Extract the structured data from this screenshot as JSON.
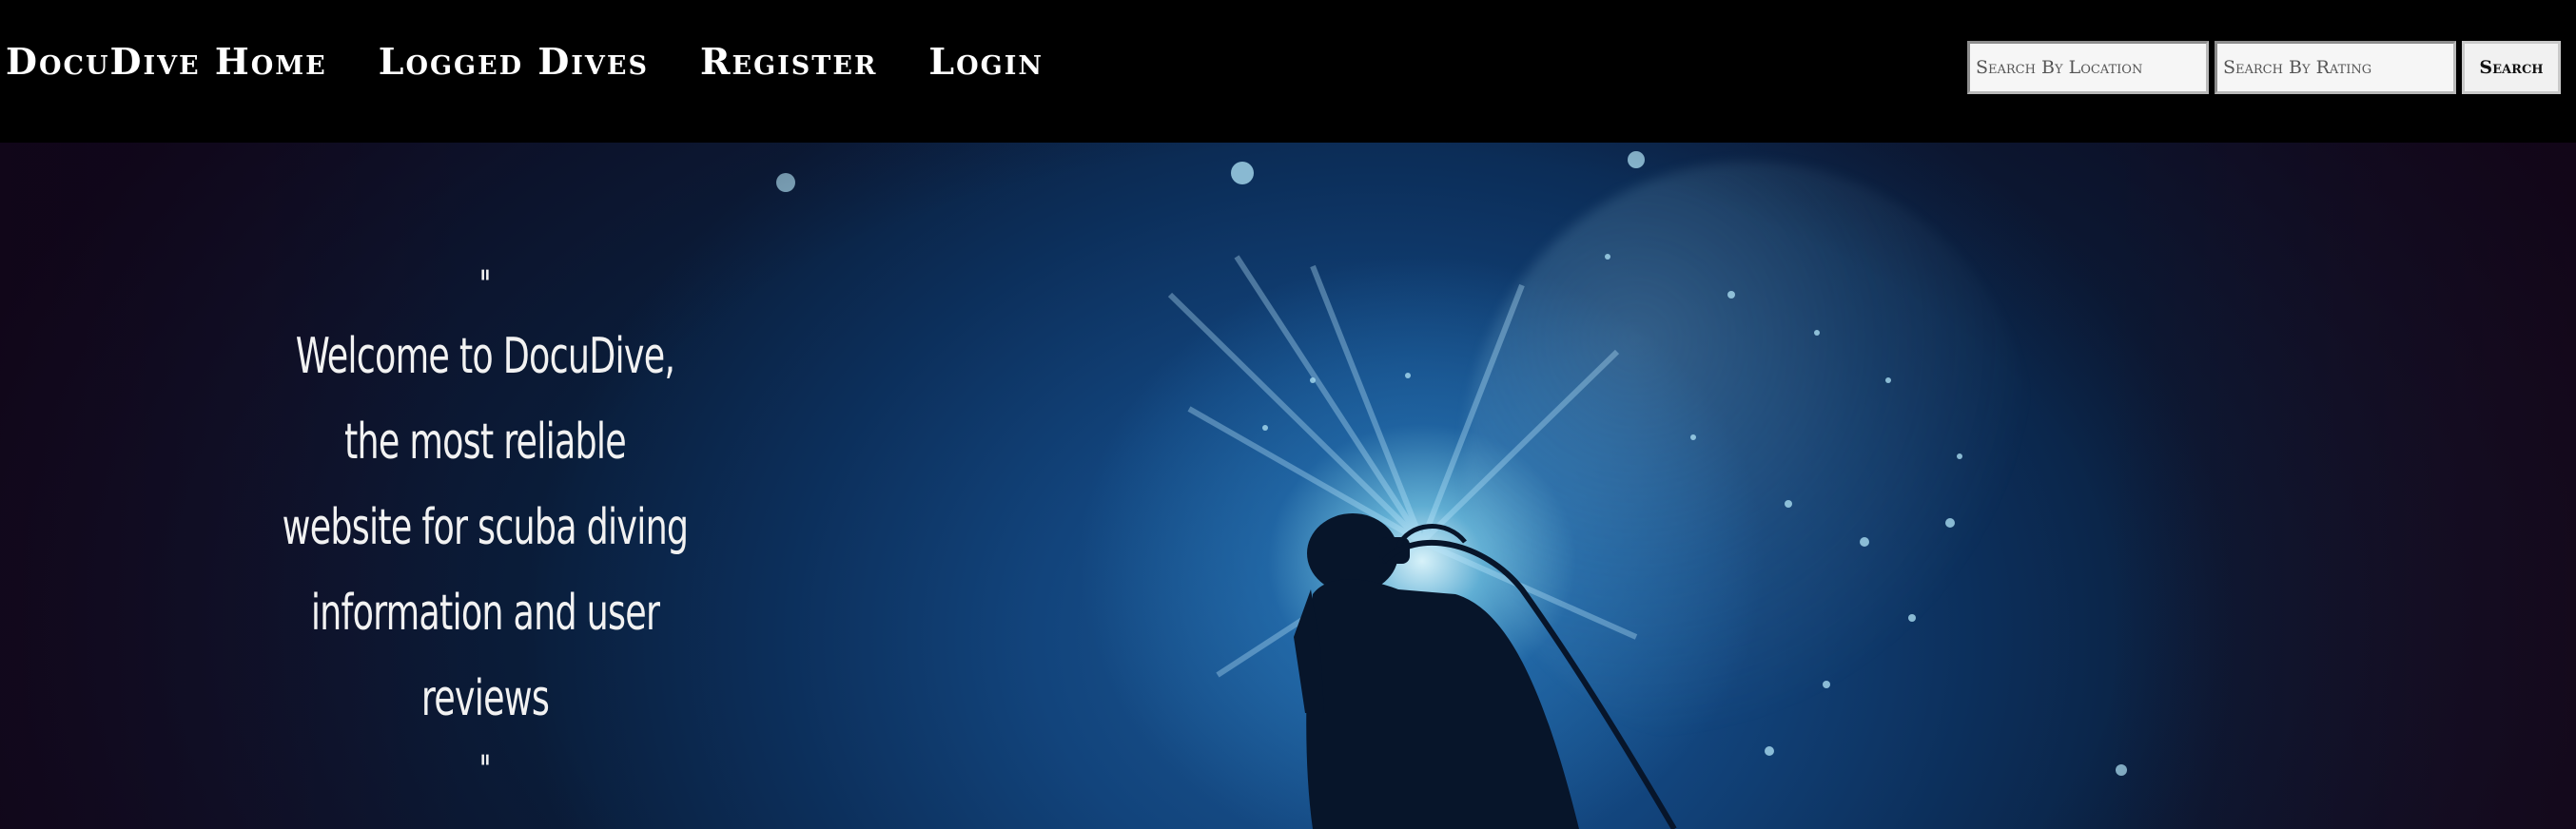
{
  "nav": {
    "links": [
      "DocuDive Home",
      "Logged Dives",
      "Register",
      "Login"
    ]
  },
  "search": {
    "location_placeholder": "Search By Location",
    "rating_placeholder": "Search By Rating",
    "button_label": "Search"
  },
  "hero": {
    "quote_open": "\"",
    "quote_text": "Welcome to DocuDive, the most reliable website for scuba diving information and user reviews",
    "quote_close": "\""
  },
  "colors": {
    "nav_background": "#000000",
    "nav_text": "#ffffff",
    "hero_deep_blue": "#0c2f5b",
    "hero_light": "#e1faff"
  },
  "icons": []
}
